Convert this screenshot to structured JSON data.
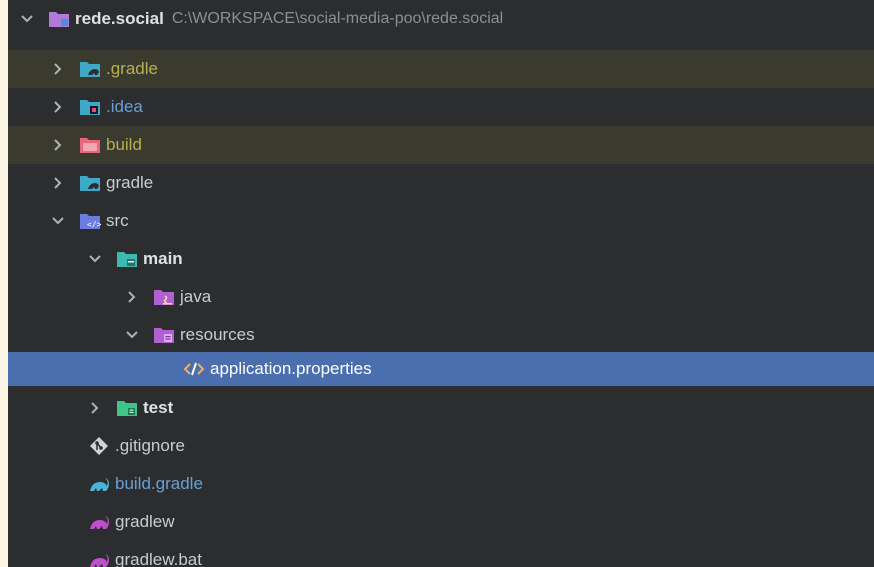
{
  "tree": {
    "root": {
      "name": "rede.social",
      "path": "C:\\WORKSPACE\\social-media-poo\\rede.social"
    },
    "items": [
      {
        "label": ".gradle",
        "icon": "gradle-folder-icon",
        "expanded": false,
        "excluded": true
      },
      {
        "label": ".idea",
        "icon": "idea-folder-icon",
        "expanded": false,
        "excluded": false
      },
      {
        "label": "build",
        "icon": "excluded-folder-icon",
        "expanded": false,
        "excluded": true
      },
      {
        "label": "gradle",
        "icon": "gradle-folder-icon",
        "expanded": false,
        "excluded": false
      },
      {
        "label": "src",
        "icon": "source-folder-icon",
        "expanded": true
      },
      {
        "label": "main",
        "icon": "module-folder-icon",
        "expanded": true
      },
      {
        "label": "java",
        "icon": "java-source-folder-icon",
        "expanded": false
      },
      {
        "label": "resources",
        "icon": "resources-folder-icon",
        "expanded": true
      },
      {
        "label": "application.properties",
        "icon": "xml-file-icon",
        "selected": true
      },
      {
        "label": "test",
        "icon": "test-folder-icon",
        "expanded": false
      },
      {
        "label": ".gitignore",
        "icon": "git-file-icon"
      },
      {
        "label": "build.gradle",
        "icon": "gradle-file-icon"
      },
      {
        "label": "gradlew",
        "icon": "gradle-script-icon"
      },
      {
        "label": "gradlew.bat",
        "icon": "gradle-script-icon"
      }
    ]
  },
  "colors": {
    "background": "#2b2d2f",
    "selected": "#4b6eaf",
    "excluded_row": "#3a3a2e",
    "excluded_text": "#b8b04e",
    "module_text": "#6a9fd6"
  }
}
